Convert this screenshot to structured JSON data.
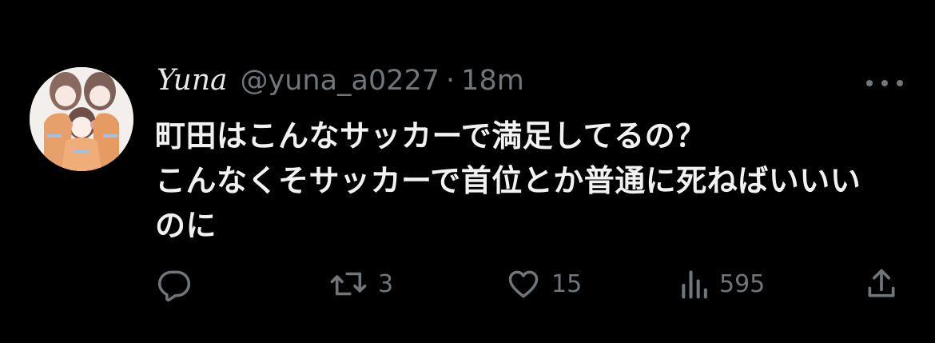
{
  "tweet": {
    "display_name": "Yuna",
    "handle": "@yuna_a0227",
    "separator": "·",
    "time": "18m",
    "text_lines": [
      "町田はこんなサッカーで満足してるの？",
      "こんなくそサッカーで首位とか普通に死ねばいいい",
      "のに"
    ],
    "actions": {
      "reply_count": "",
      "retweet_count": "3",
      "like_count": "15",
      "views_count": "595"
    }
  },
  "icons": {
    "more": "more-horizontal-icon",
    "reply": "reply-icon",
    "retweet": "retweet-icon",
    "like": "heart-icon",
    "views": "views-bar-chart-icon",
    "share": "share-icon"
  },
  "colors": {
    "background": "#000000",
    "primary_text": "#e7e9ea",
    "secondary_text": "#71767b"
  }
}
